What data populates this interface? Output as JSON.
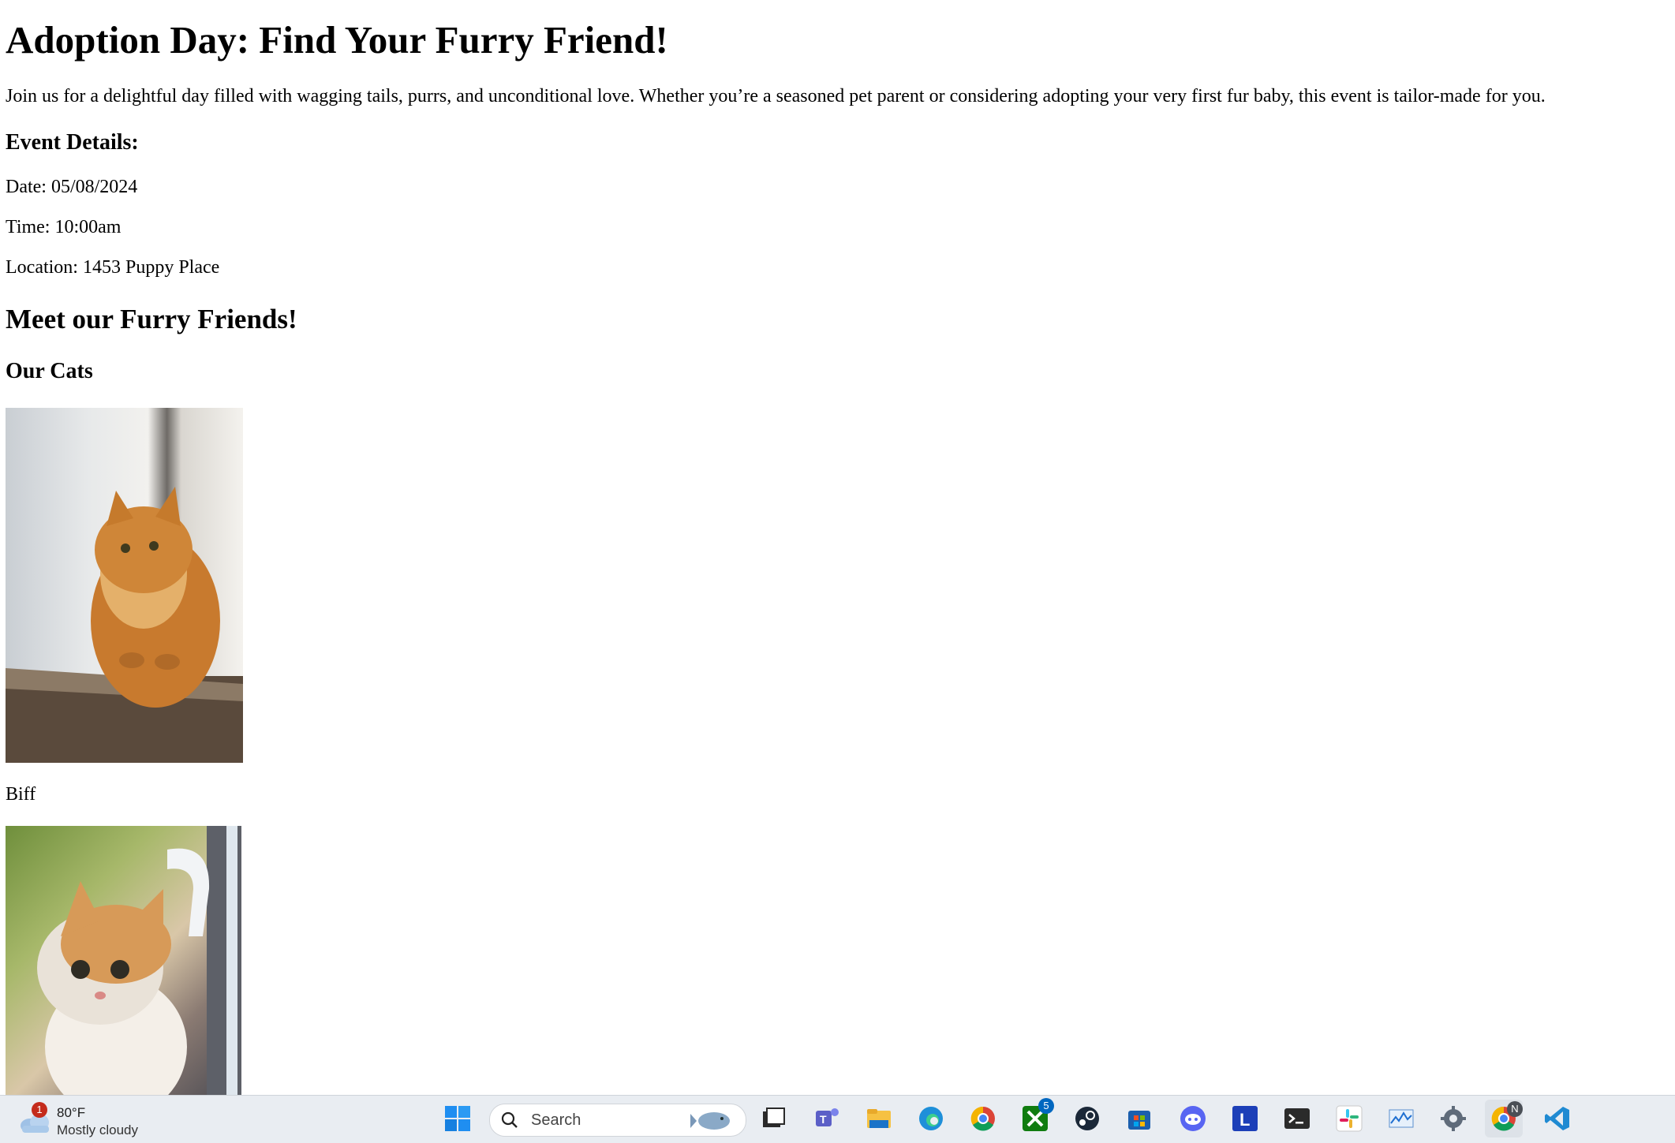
{
  "content": {
    "title": "Adoption Day: Find Your Furry Friend!",
    "intro": "Join us for a delightful day filled with wagging tails, purrs, and unconditional love. Whether you’re a seasoned pet parent or considering adopting your very first fur baby, this event is tailor-made for you.",
    "event_heading": "Event Details:",
    "date": "Date: 05/08/2024",
    "time": "Time: 10:00am",
    "location": "Location: 1453 Puppy Place",
    "meet_heading": "Meet our Furry Friends!",
    "cats_heading": "Our Cats",
    "cats": [
      {
        "name": "Biff"
      },
      {
        "name": ""
      }
    ]
  },
  "taskbar": {
    "weather": {
      "temp": "80°F",
      "condition": "Mostly cloudy",
      "badge": "1"
    },
    "search_placeholder": "Search",
    "xbox_badge": "5",
    "chrome_profile_badge": "N",
    "icons": [
      "start-icon",
      "search-icon",
      "task-view-icon",
      "teams-icon",
      "file-explorer-icon",
      "edge-icon",
      "chrome-icon",
      "xbox-icon",
      "steam-icon",
      "store-icon",
      "discord-icon",
      "l-app-icon",
      "terminal-icon",
      "slack-icon",
      "performance-monitor-icon",
      "settings-icon",
      "chrome-profile-icon",
      "vscode-icon"
    ],
    "colors": {
      "accent": "#0078d4",
      "taskbar_bg": "#e9edf2"
    }
  }
}
